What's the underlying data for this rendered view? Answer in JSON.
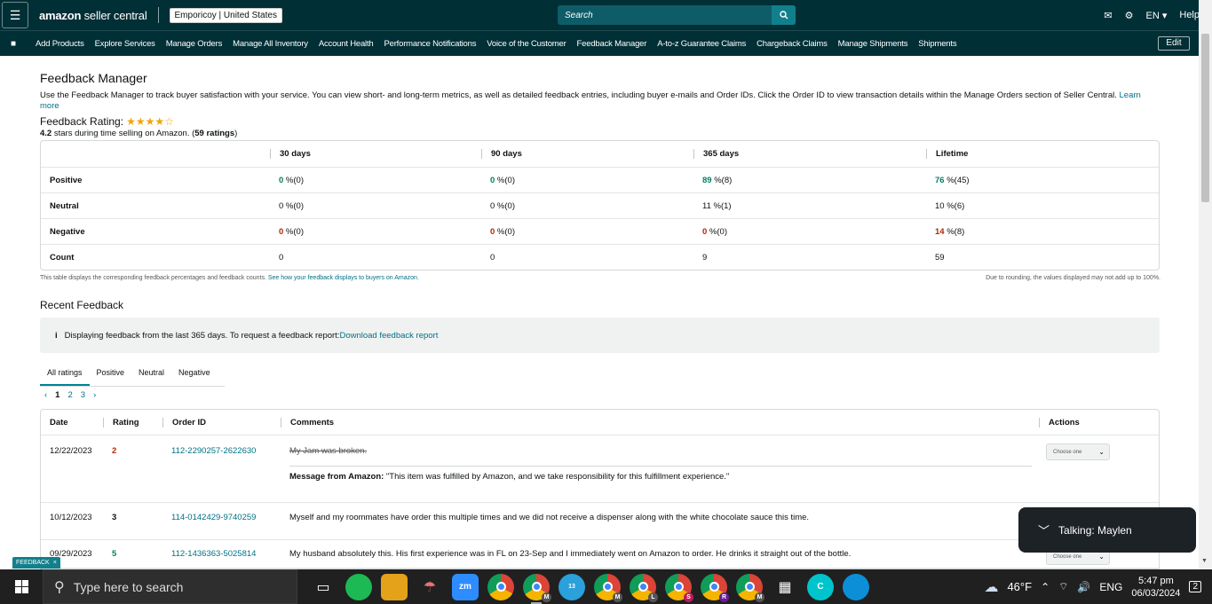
{
  "topbar": {
    "logo_brand": "amazon",
    "logo_suffix": " seller central",
    "account": "Emporicoy | United States",
    "search_placeholder": "Search",
    "lang": "EN ▾",
    "help": "Help"
  },
  "nav": {
    "items": [
      "Add Products",
      "Explore Services",
      "Manage Orders",
      "Manage All Inventory",
      "Account Health",
      "Performance Notifications",
      "Voice of the Customer",
      "Feedback Manager",
      "A-to-z Guarantee Claims",
      "Chargeback Claims",
      "Manage Shipments",
      "Shipments"
    ],
    "edit": "Edit"
  },
  "page": {
    "title": "Feedback Manager",
    "description": "Use the Feedback Manager to track buyer satisfaction with your service. You can view short- and long-term metrics, as well as detailed feedback entries, including buyer e-mails and Order IDs. Click the Order ID to view transaction details within the Manage Orders section of Seller Central.",
    "learn_more": "Learn more",
    "rating_label": "Feedback Rating:",
    "rating_value": "4.2",
    "rating_text": " stars during time selling on Amazon. (",
    "rating_count": "59 ratings",
    "rating_close": ")",
    "stars_filled": 4,
    "stars_total": 5
  },
  "summary": {
    "headers": [
      "",
      "30 days",
      "90 days",
      "365 days",
      "Lifetime"
    ],
    "rows": [
      {
        "label": "Positive",
        "cells": [
          {
            "v": "0",
            "s": " %(0)",
            "c": "g"
          },
          {
            "v": "0",
            "s": " %(0)",
            "c": "g"
          },
          {
            "v": "89",
            "s": " %(8)",
            "c": "g"
          },
          {
            "v": "76",
            "s": " %(45)",
            "c": "g"
          }
        ]
      },
      {
        "label": "Neutral",
        "cells": [
          {
            "v": "0",
            "s": " %(0)",
            "c": "n"
          },
          {
            "v": "0",
            "s": " %(0)",
            "c": "n"
          },
          {
            "v": "11",
            "s": " %(1)",
            "c": "n"
          },
          {
            "v": "10",
            "s": " %(6)",
            "c": "n"
          }
        ]
      },
      {
        "label": "Negative",
        "cells": [
          {
            "v": "0",
            "s": " %(0)",
            "c": "r"
          },
          {
            "v": "0",
            "s": " %(0)",
            "c": "r"
          },
          {
            "v": "0",
            "s": " %(0)",
            "c": "r"
          },
          {
            "v": "14",
            "s": " %(8)",
            "c": "r"
          }
        ]
      },
      {
        "label": "Count",
        "cells": [
          {
            "v": "0",
            "s": "",
            "c": "n"
          },
          {
            "v": "0",
            "s": "",
            "c": "n"
          },
          {
            "v": "9",
            "s": "",
            "c": "n"
          },
          {
            "v": "59",
            "s": "",
            "c": "n"
          }
        ]
      }
    ],
    "foot_left": "This table displays the corresponding feedback percentages and feedback counts. ",
    "foot_link": "See how your feedback displays to buyers on Amazon.",
    "foot_right": "Due to rounding, the values displayed may not add up to 100%."
  },
  "recent": {
    "title": "Recent Feedback",
    "info_icon": "i",
    "info_text": "Displaying feedback from the last 365 days. To request a feedback report: ",
    "info_link": "Download feedback report",
    "tabs": [
      "All ratings",
      "Positive",
      "Neutral",
      "Negative"
    ],
    "pages": [
      "1",
      "2",
      "3"
    ],
    "columns": [
      "Date",
      "Rating",
      "Order ID",
      "Comments",
      "Actions"
    ],
    "rows": [
      {
        "date": "12/22/2023",
        "rating": "2",
        "rating_color": "#b12704",
        "order": "112-2290257-2622630",
        "comment": "My Jam was broken.",
        "struck": true,
        "msg_label": "Message from Amazon:",
        "msg": " \"This item was fulfilled by Amazon, and we take responsibility for this fulfillment experience.\"",
        "action": "Choose one"
      },
      {
        "date": "10/12/2023",
        "rating": "3",
        "rating_color": "#0f1111",
        "order": "114-0142429-9740259",
        "comment": "Myself and my roommates have order this multiple times and we did not receive a dispenser along with the white chocolate sauce this time.",
        "struck": false,
        "msg_label": "",
        "msg": "",
        "action": ""
      },
      {
        "date": "09/29/2023",
        "rating": "5",
        "rating_color": "#067d62",
        "order": "112-1436363-5025814",
        "comment": "My husband absolutely this. His first experience was in FL on 23-Sep and I immediately went on Amazon to order. He drinks it straight out of the bottle.",
        "struck": false,
        "msg_label": "",
        "msg": "",
        "action": "Choose one"
      }
    ]
  },
  "toast": {
    "text": "Talking: Maylen"
  },
  "feedback_tag": {
    "label": "FEEDBACK",
    "close": "×"
  },
  "taskbar": {
    "search_placeholder": "Type here to search",
    "weather": "46°F",
    "lang": "ENG",
    "time": "5:47 pm",
    "date": "06/03/2024",
    "notifications": "2",
    "apps": [
      {
        "name": "task-view",
        "label": "",
        "color": "#202020"
      },
      {
        "name": "spotify",
        "label": "",
        "color": "#1db954"
      },
      {
        "name": "app-yellow",
        "label": "",
        "color": "#e3a21a"
      },
      {
        "name": "app-umbrella",
        "label": "",
        "color": "#202020"
      },
      {
        "name": "zoom",
        "label": "zm",
        "color": "#2d8cff"
      },
      {
        "name": "chrome-profile-1",
        "label": "",
        "color": "#3c8a3c"
      },
      {
        "name": "chrome-profile-m",
        "label": "M",
        "color": "#3c8a3c"
      },
      {
        "name": "telegram",
        "label": "13",
        "color": "#2aa1da"
      },
      {
        "name": "chrome-profile-3",
        "label": "M",
        "color": "#3c8a3c"
      },
      {
        "name": "chrome-profile-4",
        "label": "L",
        "color": "#3c8a3c"
      },
      {
        "name": "chrome-profile-5",
        "label": "S",
        "color": "#c0392b"
      },
      {
        "name": "chrome-profile-6",
        "label": "R",
        "color": "#3c8a3c"
      },
      {
        "name": "chrome-profile-7",
        "label": "M",
        "color": "#3c8a3c"
      },
      {
        "name": "calculator",
        "label": "",
        "color": "#555"
      },
      {
        "name": "canva",
        "label": "C",
        "color": "#00c4cc"
      },
      {
        "name": "edge",
        "label": "",
        "color": "#0c8fd6"
      }
    ]
  }
}
